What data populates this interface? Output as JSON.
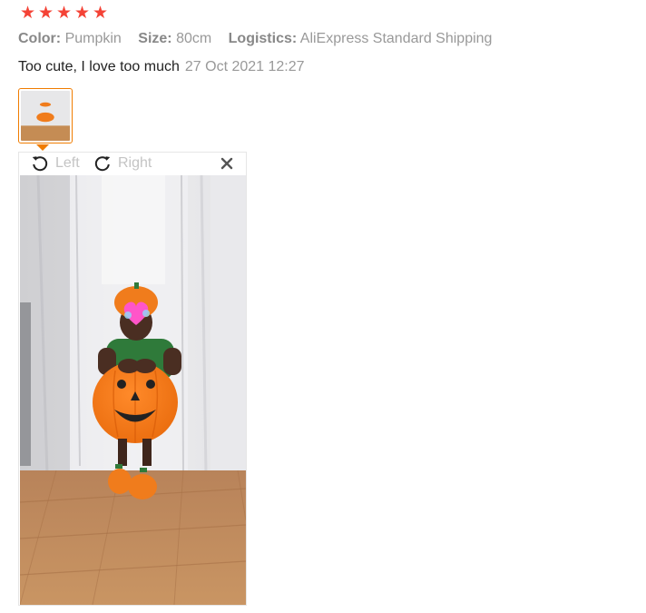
{
  "review": {
    "rating": 5,
    "stars": [
      "★",
      "★",
      "★",
      "★",
      "★"
    ],
    "star_color": "#f44336",
    "color_label": "Color:",
    "color_value": "Pumpkin",
    "size_label": "Size:",
    "size_value": "80cm",
    "logistics_label": "Logistics:",
    "logistics_value": "AliExpress Standard Shipping",
    "comment": "Too cute, I love too much",
    "date": "27 Oct 2021 12:27"
  },
  "viewer": {
    "left_label": "Left",
    "right_label": "Right",
    "close_icon": "close-icon",
    "rotate_left_icon": "rotate-left-icon",
    "rotate_right_icon": "rotate-right-icon",
    "accent": "#f07c00"
  }
}
